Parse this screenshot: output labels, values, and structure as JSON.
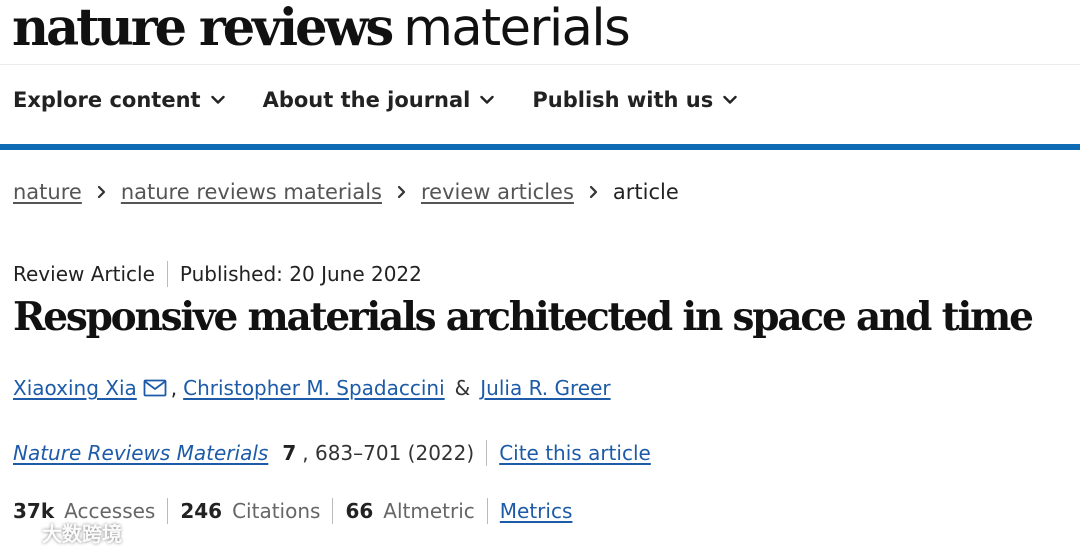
{
  "brand": {
    "logo_bold": "nature reviews",
    "logo_light": "materials",
    "accent_color": "#0f6cb4",
    "link_color": "#1d5ba8"
  },
  "nav": {
    "items": [
      {
        "label": "Explore content",
        "icon": "chevron-down-icon"
      },
      {
        "label": "About the journal",
        "icon": "chevron-down-icon"
      },
      {
        "label": "Publish with us",
        "icon": "chevron-down-icon"
      }
    ]
  },
  "breadcrumb": {
    "items": [
      "nature",
      "nature reviews materials",
      "review articles"
    ],
    "current": "article",
    "separator_icon": "chevron-right-icon"
  },
  "article": {
    "type": "Review Article",
    "published": "Published: 20 June 2022",
    "title": "Responsive materials architected in space and time",
    "authors": [
      "Xiaoxing Xia",
      "Christopher M. Spadaccini",
      "Julia R. Greer"
    ],
    "author_sep": ",",
    "author_amp": "&",
    "corresponding_icon": "mail-icon",
    "journal": "Nature Reviews Materials",
    "volume": "7",
    "pages": ", 683–701 (2022)",
    "cite_label": "Cite this article"
  },
  "metrics": {
    "accesses_value": "37k",
    "accesses_label": "Accesses",
    "citations_value": "246",
    "citations_label": "Citations",
    "altmetric_value": "66",
    "altmetric_label": "Altmetric",
    "metrics_link": "Metrics"
  },
  "watermark": {
    "text": "大数跨境",
    "icon": "logo-mark-icon"
  }
}
